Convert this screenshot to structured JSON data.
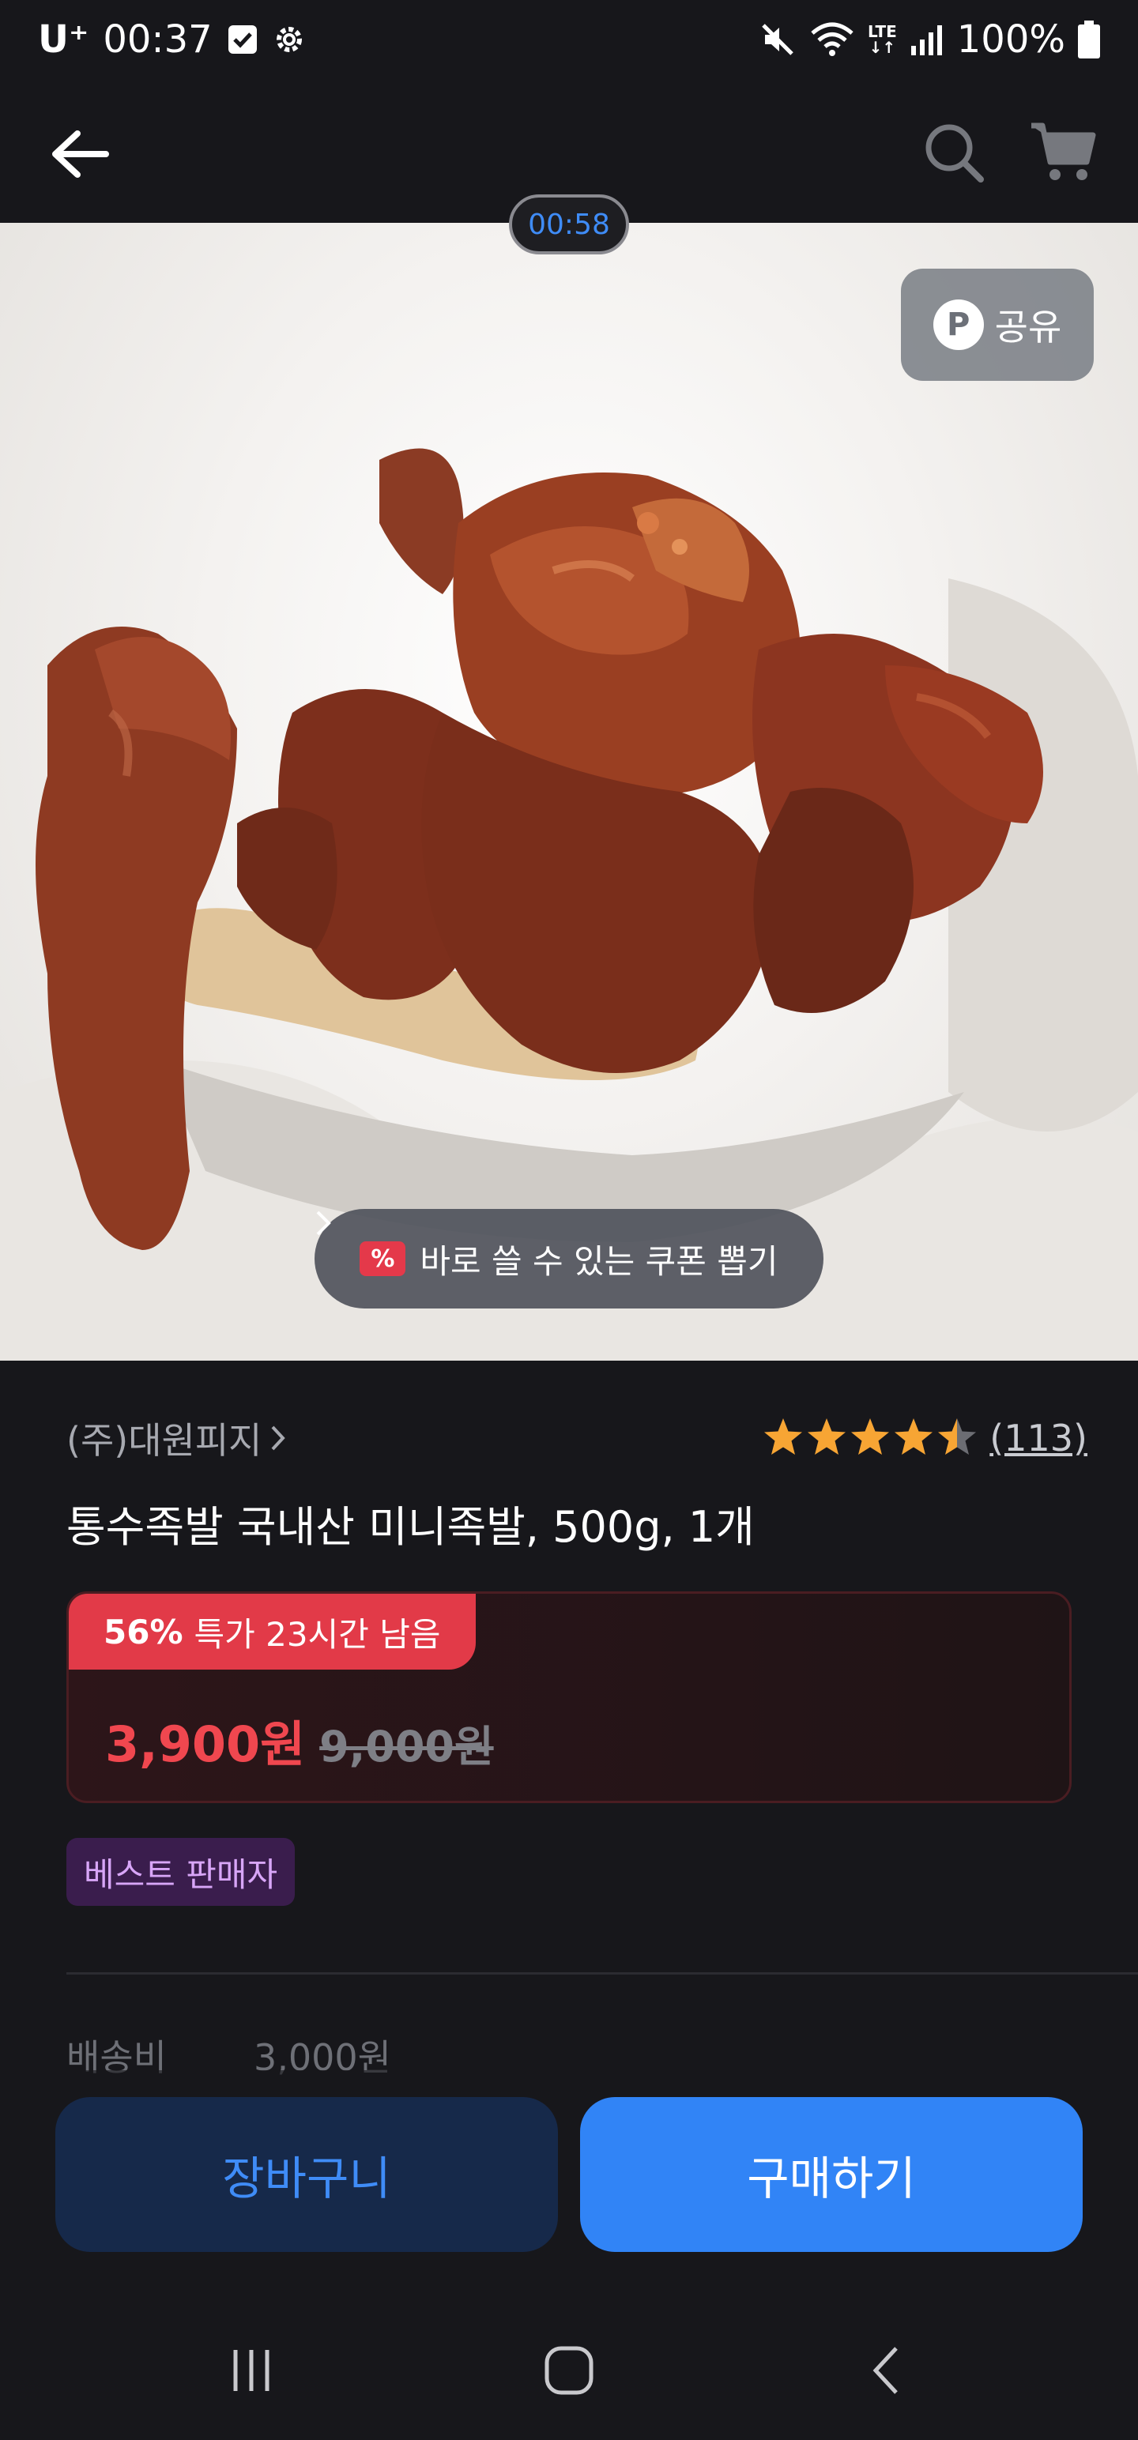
{
  "status_bar": {
    "carrier": "U⁺",
    "time": "00:37",
    "battery": "100%",
    "network": "LTE",
    "icons": [
      "check-box-icon",
      "settings-gear-icon",
      "mute-icon",
      "wifi-icon",
      "lte-icon",
      "signal-icon",
      "battery-icon"
    ]
  },
  "header": {
    "icons": [
      "back-arrow-icon",
      "search-icon",
      "cart-icon"
    ]
  },
  "hero": {
    "timer": "00:58",
    "share_badge": "P",
    "share_label": "공유",
    "coupon_badge": "%",
    "coupon_label": "바로 쓸 수 있는 쿠폰 뽑기"
  },
  "product": {
    "seller": "(주)대원피지",
    "rating_stars": 4.5,
    "review_count": "(113)",
    "title": "통수족발 국내산 미니족발, 500g, 1개",
    "deal": {
      "percent": "56%",
      "label": "특가 23시간 남음"
    },
    "sale_price": "3,900원",
    "original_price": "9,000원",
    "badge": "베스트 판매자",
    "shipping_label": "배송비",
    "shipping_value": "3,000원"
  },
  "actions": {
    "cart": "장바구니",
    "buy": "구매하기"
  },
  "nav": {
    "icons": [
      "recent-apps-icon",
      "home-icon",
      "back-icon"
    ]
  },
  "colors": {
    "background": "#17171b",
    "accent_blue": "#3184f6",
    "sale_red": "#f0474f",
    "deal_red": "#e23a48",
    "star": "#f7a534",
    "badge_purple": "#d8a6f8"
  }
}
